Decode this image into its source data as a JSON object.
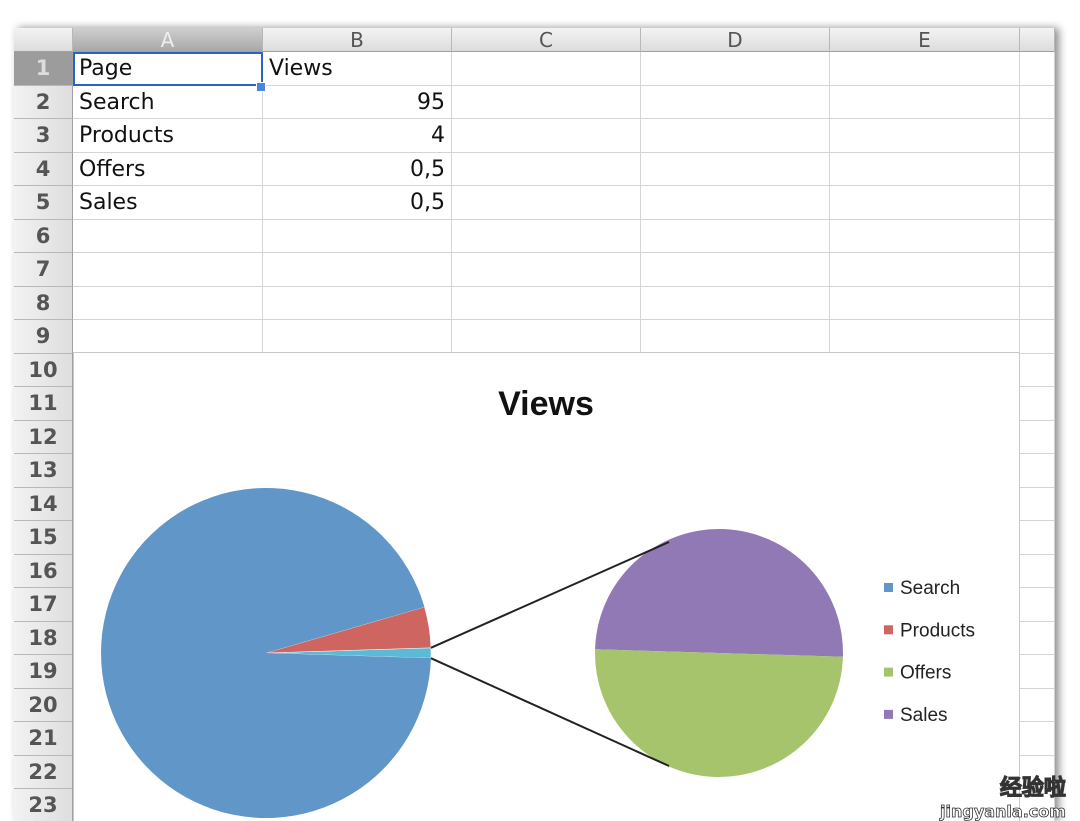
{
  "columns": [
    "A",
    "B",
    "C",
    "D",
    "E"
  ],
  "rows": [
    "1",
    "2",
    "3",
    "4",
    "5",
    "6",
    "7",
    "8",
    "9",
    "10",
    "11",
    "12",
    "13",
    "14",
    "15",
    "16",
    "17",
    "18",
    "19",
    "20",
    "21",
    "22",
    "23"
  ],
  "cells": [
    [
      "Page",
      "Views"
    ],
    [
      "Search",
      "95"
    ],
    [
      "Products",
      "4"
    ],
    [
      "Offers",
      "0,5"
    ],
    [
      "Sales",
      "0,5"
    ]
  ],
  "active_cell": "A1",
  "chart_data": {
    "type": "pie",
    "subtype": "pie-of-pie",
    "title": "Views",
    "categories": [
      "Search",
      "Products",
      "Offers",
      "Sales"
    ],
    "values": [
      95,
      4,
      0.5,
      0.5
    ],
    "secondary_plot": [
      "Offers",
      "Sales"
    ],
    "legend": {
      "position": "right",
      "entries": [
        "Search",
        "Products",
        "Offers",
        "Sales"
      ]
    },
    "colors": {
      "Search": "#6096c8",
      "Products": "#cf6560",
      "Offers": "#a6c46c",
      "Sales": "#9179b5",
      "Other": "#5bbad5"
    }
  },
  "watermark": {
    "text": "经验啦",
    "url": "jingyanla.com"
  }
}
